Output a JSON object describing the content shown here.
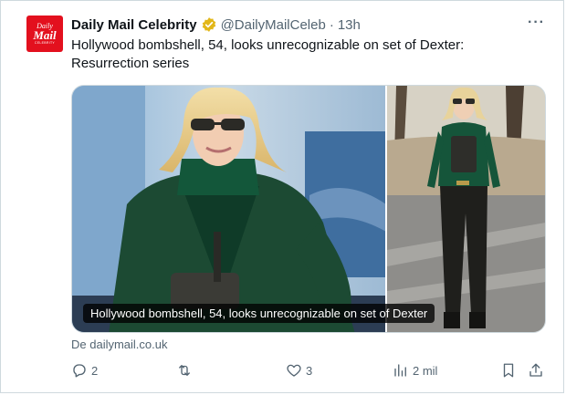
{
  "tweet": {
    "author": "Daily Mail Celebrity",
    "handle": "@DailyMailCeleb",
    "separator": "·",
    "time": "13h",
    "more_label": "···",
    "text": "Hollywood bombshell, 54, looks unrecognizable on set of Dexter: Resurrection series",
    "avatar": {
      "line1": "Daily",
      "line2": "Mail",
      "line3": "CELEBRITY"
    }
  },
  "media": {
    "caption": "Hollywood bombshell, 54, looks unrecognizable on set of Dexter"
  },
  "source": "De dailymail.co.uk",
  "actions": {
    "replies": "2",
    "retweets": "",
    "likes": "3",
    "views": "2 mil"
  },
  "icons": {
    "verified": "verified-badge-icon",
    "reply": "reply-icon",
    "retweet": "retweet-icon",
    "like": "heart-icon",
    "views": "views-icon",
    "bookmark": "bookmark-icon",
    "share": "share-icon"
  },
  "colors": {
    "avatar_red": "#e3101e",
    "verified_gold": "#e2b719",
    "muted": "#536471"
  }
}
